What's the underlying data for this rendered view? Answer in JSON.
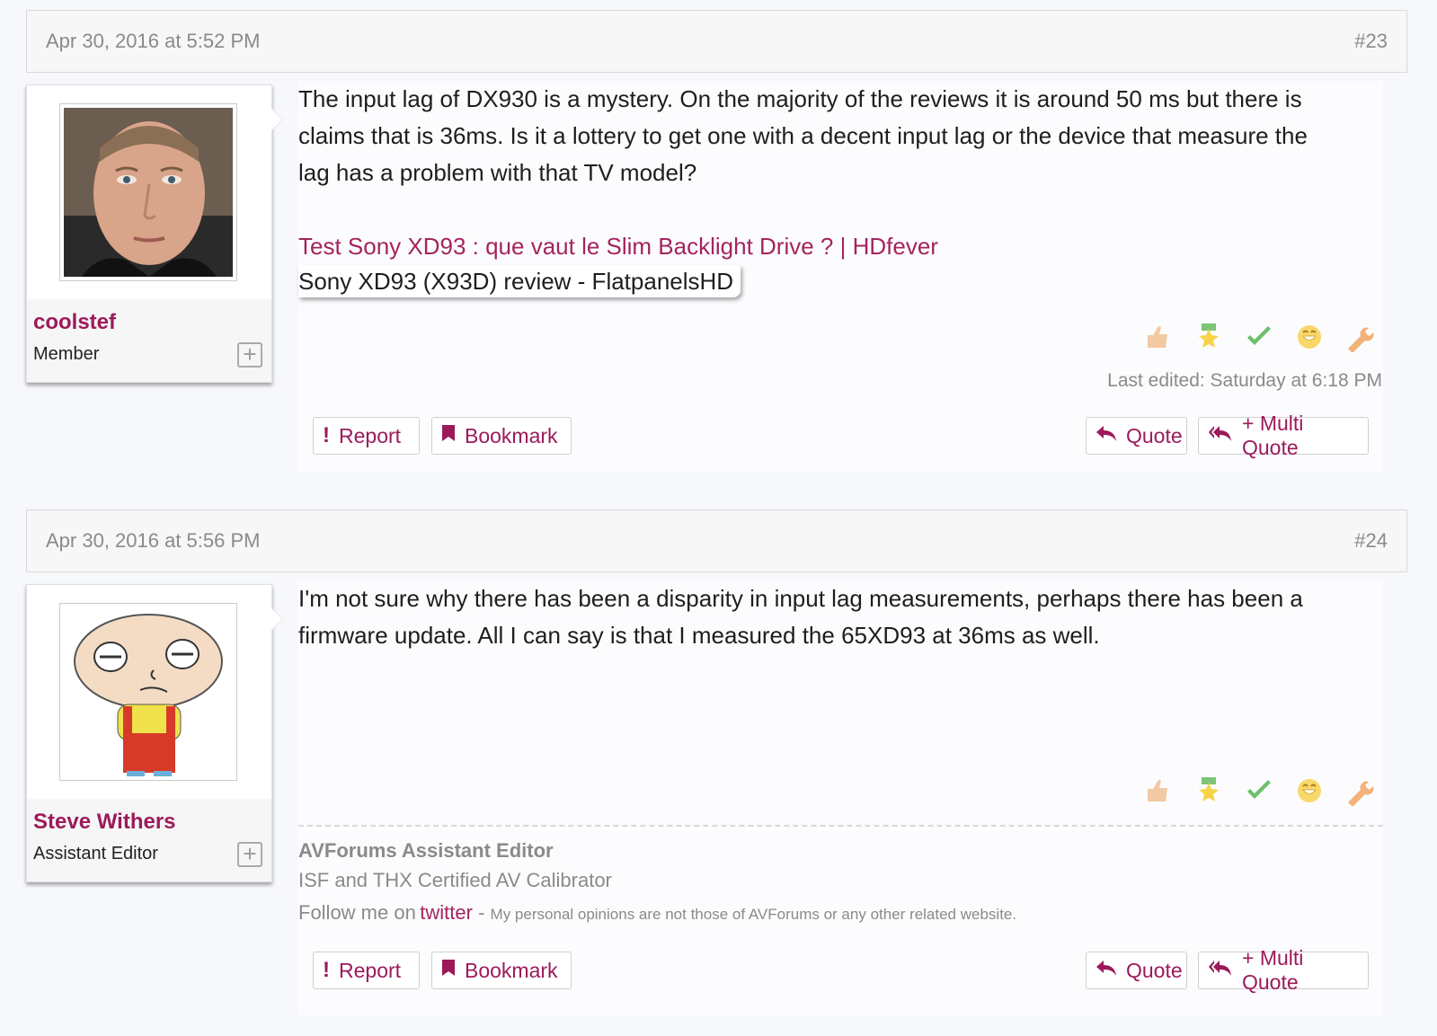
{
  "posts": [
    {
      "date": "Apr 30, 2016 at 5:52 PM",
      "number": "#23",
      "user": {
        "name": "coolstef",
        "title": "Member",
        "avatar": "portrait-photo"
      },
      "body_lines": [
        "The input lag of DX930 is a mystery. On the majority of the reviews it is around 50 ms but there is",
        "claims that is 36ms. Is it a lottery to get one with a decent input lag or the device that measure the",
        "lag has a problem with that TV model?"
      ],
      "link1": "Test Sony XD93 : que vaut le Slim Backlight Drive ? | HDfever",
      "link2": "Sony XD93 (X93D) review - FlatpanelsHD",
      "last_edited": "Last edited: Saturday at 6:18 PM",
      "actions": {
        "report": "Report",
        "bookmark": "Bookmark",
        "quote": "Quote",
        "multi_quote": "+ Multi Quote"
      }
    },
    {
      "date": "Apr 30, 2016 at 5:56 PM",
      "number": "#24",
      "user": {
        "name": "Steve Withers",
        "title": "Assistant Editor",
        "avatar": "cartoon-character"
      },
      "body_lines": [
        "I'm not sure why there has been a disparity in input lag measurements, perhaps there has been a",
        "firmware update. All I can say is that I measured the 65XD93 at 36ms as well."
      ],
      "signature": {
        "title": "AVForums Assistant Editor",
        "line1": "ISF and THX Certified AV Calibrator",
        "follow_prefix": "Follow me on",
        "follow_link": "twitter",
        "follow_dash": " - ",
        "disclaimer": "My personal opinions are not those of AVForums or any other related website."
      },
      "actions": {
        "report": "Report",
        "bookmark": "Bookmark",
        "quote": "Quote",
        "multi_quote": "+ Multi Quote"
      }
    }
  ],
  "reaction_icons": [
    "thumbs-up-icon",
    "star-award-icon",
    "checkmark-icon",
    "smile-icon",
    "wrench-icon"
  ],
  "colors": {
    "accent": "#9c1a5a",
    "link": "#a4245e",
    "muted": "#8a8a8a"
  }
}
